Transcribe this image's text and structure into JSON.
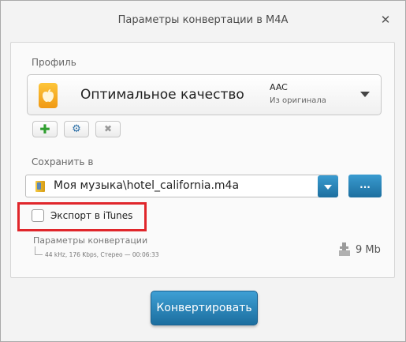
{
  "window": {
    "title": "Параметры конвертации в M4A",
    "close_glyph": "✕"
  },
  "profile": {
    "section_label": "Профиль",
    "name": "Оптимальное качество",
    "codec": "AAC",
    "codec_sub": "Из оригинала",
    "icon": "apple-icon",
    "icon_color": "#f5aa1f"
  },
  "profile_tools": {
    "add_glyph": "✚",
    "settings_glyph": "⚙",
    "remove_glyph": "✖"
  },
  "output": {
    "section_label": "Сохранить в",
    "path": "Моя музыка\\hotel_california.m4a",
    "browse_label": "..."
  },
  "itunes": {
    "label": "Экспорт в iTunes",
    "checked": false,
    "highlight_color": "#e0262b"
  },
  "conversion_params": {
    "title": "Параметры конвертации",
    "details": "44 kHz, 176 Kbps, Стерео — 00:06:33",
    "size": "9 Mb"
  },
  "convert_button": {
    "label": "Конвертировать",
    "color": "#2680b8"
  }
}
